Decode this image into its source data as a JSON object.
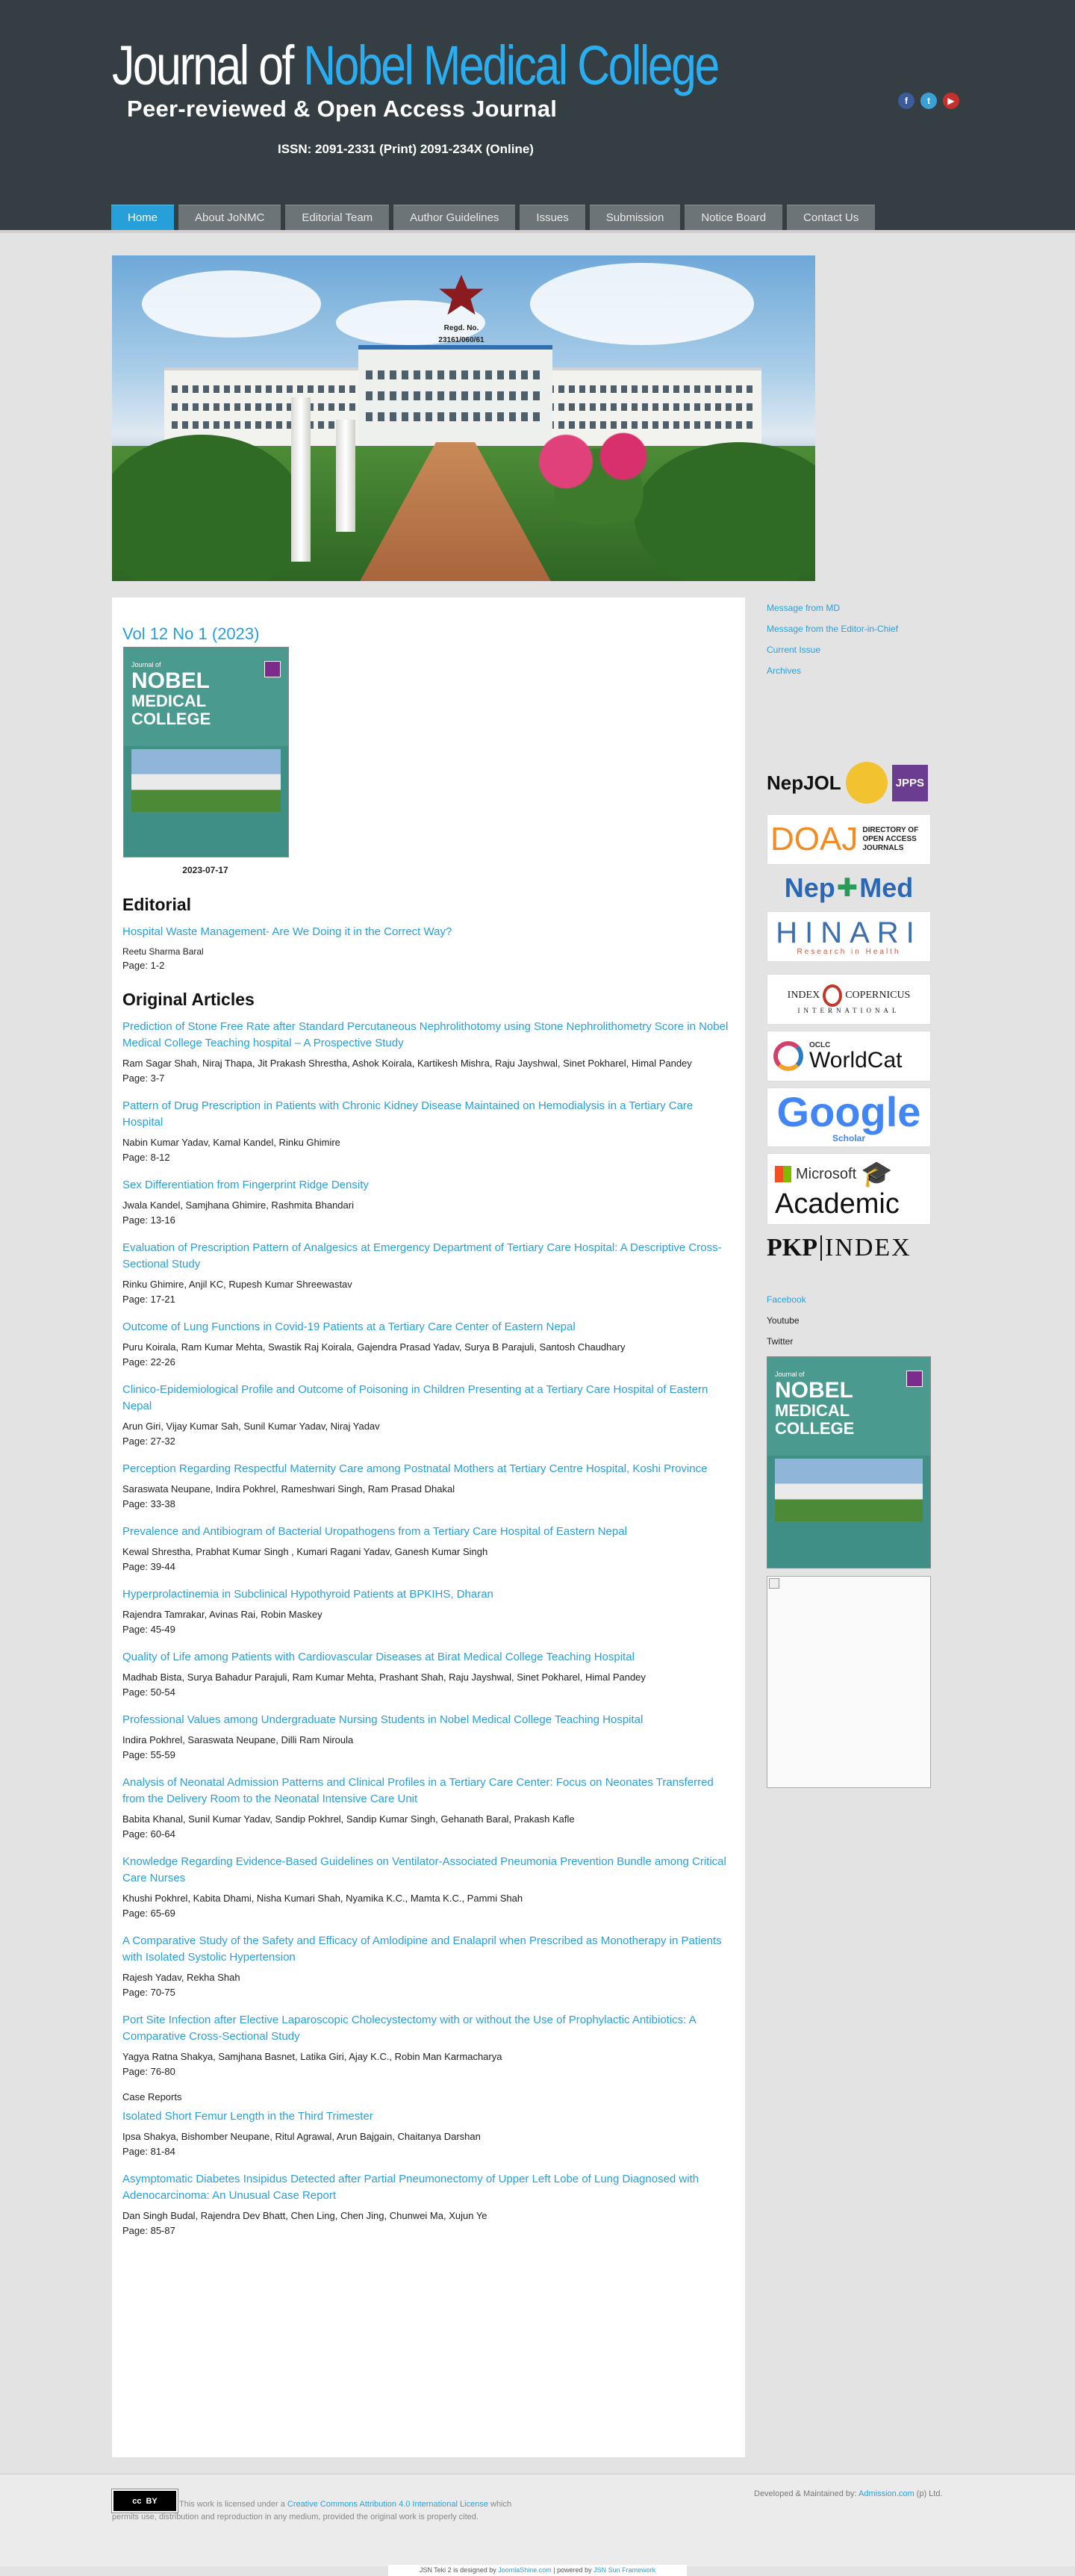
{
  "header": {
    "logo_prefix": "Journal of ",
    "logo_accent": "Nobel Medical College",
    "tagline": "Peer-reviewed & Open Access Journal",
    "issn": "ISSN: 2091-2331 (Print) 2091-234X (Online)",
    "social": [
      "f",
      "t",
      "▶"
    ]
  },
  "nav": [
    {
      "label": "Home",
      "active": true
    },
    {
      "label": "About JoNMC"
    },
    {
      "label": "Editorial Team"
    },
    {
      "label": "Author Guidelines"
    },
    {
      "label": "Issues"
    },
    {
      "label": "Submission"
    },
    {
      "label": "Notice Board"
    },
    {
      "label": "Contact Us"
    }
  ],
  "hero": {
    "regd_label": "Regd. No.",
    "regd_number": "23161/060/61"
  },
  "issue": {
    "title": "Vol 12 No 1 (2023)",
    "date": "2023-07-17",
    "cover_journal": "Journal of",
    "cover_nobel": "NOBEL",
    "cover_medical": "MEDICAL COLLEGE"
  },
  "editorial": {
    "heading": "Editorial",
    "articles": [
      {
        "title": "Hospital Waste Management- Are We Doing it in the Correct Way?",
        "authors": "Reetu Sharma Baral",
        "pages": "Page: 1-2"
      }
    ]
  },
  "original": {
    "heading": "Original Articles",
    "articles": [
      {
        "title": "Prediction of Stone Free Rate after Standard Percutaneous Nephrolithotomy using Stone Nephrolithometry Score in Nobel Medical College Teaching hospital – A Prospective Study",
        "authors": "Ram Sagar Shah, Niraj Thapa, Jit Prakash Shrestha, Ashok Koirala, Kartikesh Mishra, Raju Jayshwal, Sinet Pokharel, Himal Pandey",
        "pages": "Page: 3-7"
      },
      {
        "title": "Pattern of Drug Prescription in Patients with Chronic Kidney Disease Maintained on Hemodialysis in a Tertiary Care Hospital",
        "authors": "Nabin Kumar Yadav, Kamal Kandel, Rinku Ghimire",
        "pages": "Page: 8-12"
      },
      {
        "title": "Sex Differentiation from Fingerprint Ridge Density",
        "authors": "Jwala Kandel, Samjhana Ghimire, Rashmita Bhandari",
        "pages": "Page: 13-16"
      },
      {
        "title": "Evaluation of Prescription Pattern of Analgesics at Emergency Department of Tertiary Care Hospital: A Descriptive Cross-Sectional Study",
        "authors": "Rinku Ghimire, Anjil KC, Rupesh Kumar Shreewastav",
        "pages": "Page: 17-21"
      },
      {
        "title": "Outcome of Lung Functions in Covid-19 Patients at a Tertiary Care Center of Eastern Nepal",
        "authors": "Puru Koirala, Ram Kumar Mehta, Swastik Raj Koirala, Gajendra Prasad Yadav, Surya B Parajuli, Santosh Chaudhary",
        "pages": "Page: 22-26"
      },
      {
        "title": "Clinico-Epidemiological Profile and Outcome of Poisoning in Children Presenting at a Tertiary Care Hospital of Eastern Nepal",
        "authors": "Arun Giri, Vijay Kumar Sah, Sunil Kumar Yadav, Niraj Yadav",
        "pages": "Page: 27-32"
      },
      {
        "title": "Perception Regarding Respectful Maternity Care among Postnatal Mothers at Tertiary Centre Hospital, Koshi Province",
        "authors": "Saraswata Neupane, Indira Pokhrel, Rameshwari Singh, Ram Prasad Dhakal",
        "pages": "Page: 33-38"
      },
      {
        "title": "Prevalence and Antibiogram of Bacterial Uropathogens from a Tertiary Care Hospital of Eastern Nepal",
        "authors": "Kewal Shrestha, Prabhat Kumar Singh , Kumari Ragani Yadav, Ganesh Kumar Singh",
        "pages": "Page: 39-44"
      },
      {
        "title": "Hyperprolactinemia in Subclinical Hypothyroid Patients at BPKIHS, Dharan",
        "authors": "Rajendra Tamrakar, Avinas Rai, Robin Maskey",
        "pages": "Page: 45-49"
      },
      {
        "title": "Quality of Life among Patients with Cardiovascular Diseases at Birat Medical College Teaching Hospital",
        "authors": "Madhab Bista, Surya Bahadur Parajuli, Ram Kumar Mehta, Prashant Shah, Raju Jayshwal, Sinet Pokharel, Himal Pandey",
        "pages": "Page: 50-54"
      },
      {
        "title": "Professional Values among Undergraduate Nursing Students in Nobel Medical College Teaching Hospital",
        "authors": "Indira Pokhrel, Saraswata Neupane, Dilli Ram Niroula",
        "pages": "Page: 55-59"
      },
      {
        "title": "Analysis of Neonatal Admission Patterns and Clinical Profiles in a Tertiary Care Center: Focus on Neonates Transferred from the Delivery Room to the Neonatal Intensive Care Unit",
        "authors": "Babita Khanal, Sunil Kumar Yadav, Sandip Pokhrel, Sandip Kumar Singh, Gehanath Baral, Prakash Kafle",
        "pages": "Page: 60-64"
      },
      {
        "title": "Knowledge Regarding Evidence-Based Guidelines on Ventilator-Associated Pneumonia Prevention Bundle among Critical Care Nurses",
        "authors": "Khushi Pokhrel, Kabita Dhami, Nisha Kumari Shah, Nyamika K.C., Mamta K.C., Pammi Shah",
        "pages": "Page: 65-69"
      },
      {
        "title": "A Comparative Study of the Safety and Efficacy of Amlodipine and Enalapril when Prescribed as Monotherapy in Patients with Isolated Systolic Hypertension",
        "authors": "Rajesh Yadav, Rekha Shah",
        "pages": "Page: 70-75"
      },
      {
        "title": "Port Site Infection after Elective Laparoscopic Cholecystectomy with or without the Use of Prophylactic Antibiotics: A Comparative Cross-Sectional Study",
        "authors": "Yagya Ratna Shakya, Samjhana Basnet, Latika Giri, Ajay K.C., Robin Man Karmacharya",
        "pages": "Page: 76-80"
      }
    ]
  },
  "case_reports": {
    "label": "Case Reports",
    "articles": [
      {
        "title": "Isolated Short Femur Length in the Third Trimester",
        "authors": "Ipsa Shakya, Bishomber Neupane, Ritul Agrawal, Arun Bajgain, Chaitanya Darshan",
        "pages": "Page: 81-84"
      },
      {
        "title": "Asymptomatic Diabetes Insipidus Detected after Partial Pneumonectomy of Upper Left Lobe of Lung Diagnosed with Adenocarcinoma: An Unusual Case Report",
        "authors": "Dan Singh Budal, Rajendra Dev Bhatt, Chen Ling, Chen Jing, Chunwei Ma, Xujun Ye",
        "pages": "Page: 85-87"
      }
    ]
  },
  "sidebar": {
    "links": [
      "Message from MD",
      "Message from the Editor-in-Chief",
      "Current Issue",
      "Archives"
    ],
    "indexers": [
      "NepJOL",
      "JPPS",
      "DOAJ",
      "DIRECTORY OF OPEN ACCESS JOURNALS",
      "Nep",
      "Med",
      "HINARI",
      "Research in Health",
      "INDEX",
      "COPERNICUS",
      "INTERNATIONAL",
      "OCLC",
      "WorldCat",
      "Google",
      "Scholar",
      "Microsoft",
      "Academic",
      "PKP",
      "INDEX"
    ],
    "social_links": [
      "Facebook",
      "Youtube",
      "Twitter"
    ]
  },
  "footer": {
    "cc_label": "cc",
    "cc_by": "BY",
    "license_prefix": "This work is licensed under a ",
    "license_link": "Creative Commons Attribution 4.0 International License",
    "license_suffix": " which permits use, distribution and reproduction in any medium, provided the original work is properly cited.",
    "developed_prefix": "Developed & Maintained by: ",
    "developed_link": "Admission.com",
    "developed_suffix": " (p) Ltd.",
    "credits_prefix": "JSN Teki 2 is designed by ",
    "credits_link1": "JoomlaShine.com",
    "credits_mid": " | powered by ",
    "credits_link2": "JSN Sun Framework"
  }
}
